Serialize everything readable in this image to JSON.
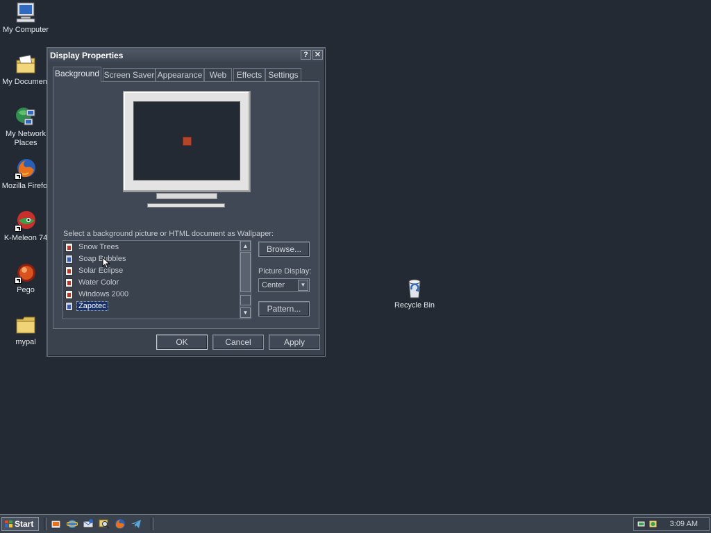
{
  "desktop": {
    "icons": [
      {
        "label": "My Computer"
      },
      {
        "label": "My Document"
      },
      {
        "label": "My Network Places"
      },
      {
        "label": "Mozilla Firefo:"
      },
      {
        "label": "K-Meleon 74"
      },
      {
        "label": "Pego"
      },
      {
        "label": "mypal"
      },
      {
        "label": "Recycle Bin"
      }
    ]
  },
  "window": {
    "title": "Display Properties",
    "help_label": "?",
    "close_label": "✕",
    "tabs": [
      {
        "label": "Background"
      },
      {
        "label": "Screen Saver"
      },
      {
        "label": "Appearance"
      },
      {
        "label": "Web"
      },
      {
        "label": "Effects"
      },
      {
        "label": "Settings"
      }
    ],
    "active_tab": "Background",
    "wallpaper_prompt": "Select a background picture or HTML document as Wallpaper:",
    "wallpapers": [
      {
        "label": "Snow Trees",
        "type": "image"
      },
      {
        "label": "Soap Bubbles",
        "type": "html"
      },
      {
        "label": "Solar Eclipse",
        "type": "image"
      },
      {
        "label": "Water Color",
        "type": "image"
      },
      {
        "label": "Windows 2000",
        "type": "image"
      },
      {
        "label": "Zapotec",
        "type": "html",
        "selected": true
      }
    ],
    "browse_label": "Browse...",
    "picture_display_label": "Picture Display:",
    "picture_display_value": "Center",
    "pattern_label": "Pattern...",
    "ok_label": "OK",
    "cancel_label": "Cancel",
    "apply_label": "Apply"
  },
  "taskbar": {
    "start_label": "Start",
    "clock": "3:09 AM",
    "quicklaunch": [
      "show-desktop-icon",
      "internet-explorer-icon",
      "outlook-express-icon",
      "search-icon",
      "firefox-icon",
      "telegram-icon"
    ]
  },
  "colors": {
    "desktop_bg": "#232a34",
    "window_bg": "#3a424e",
    "selection": "#15326b"
  }
}
